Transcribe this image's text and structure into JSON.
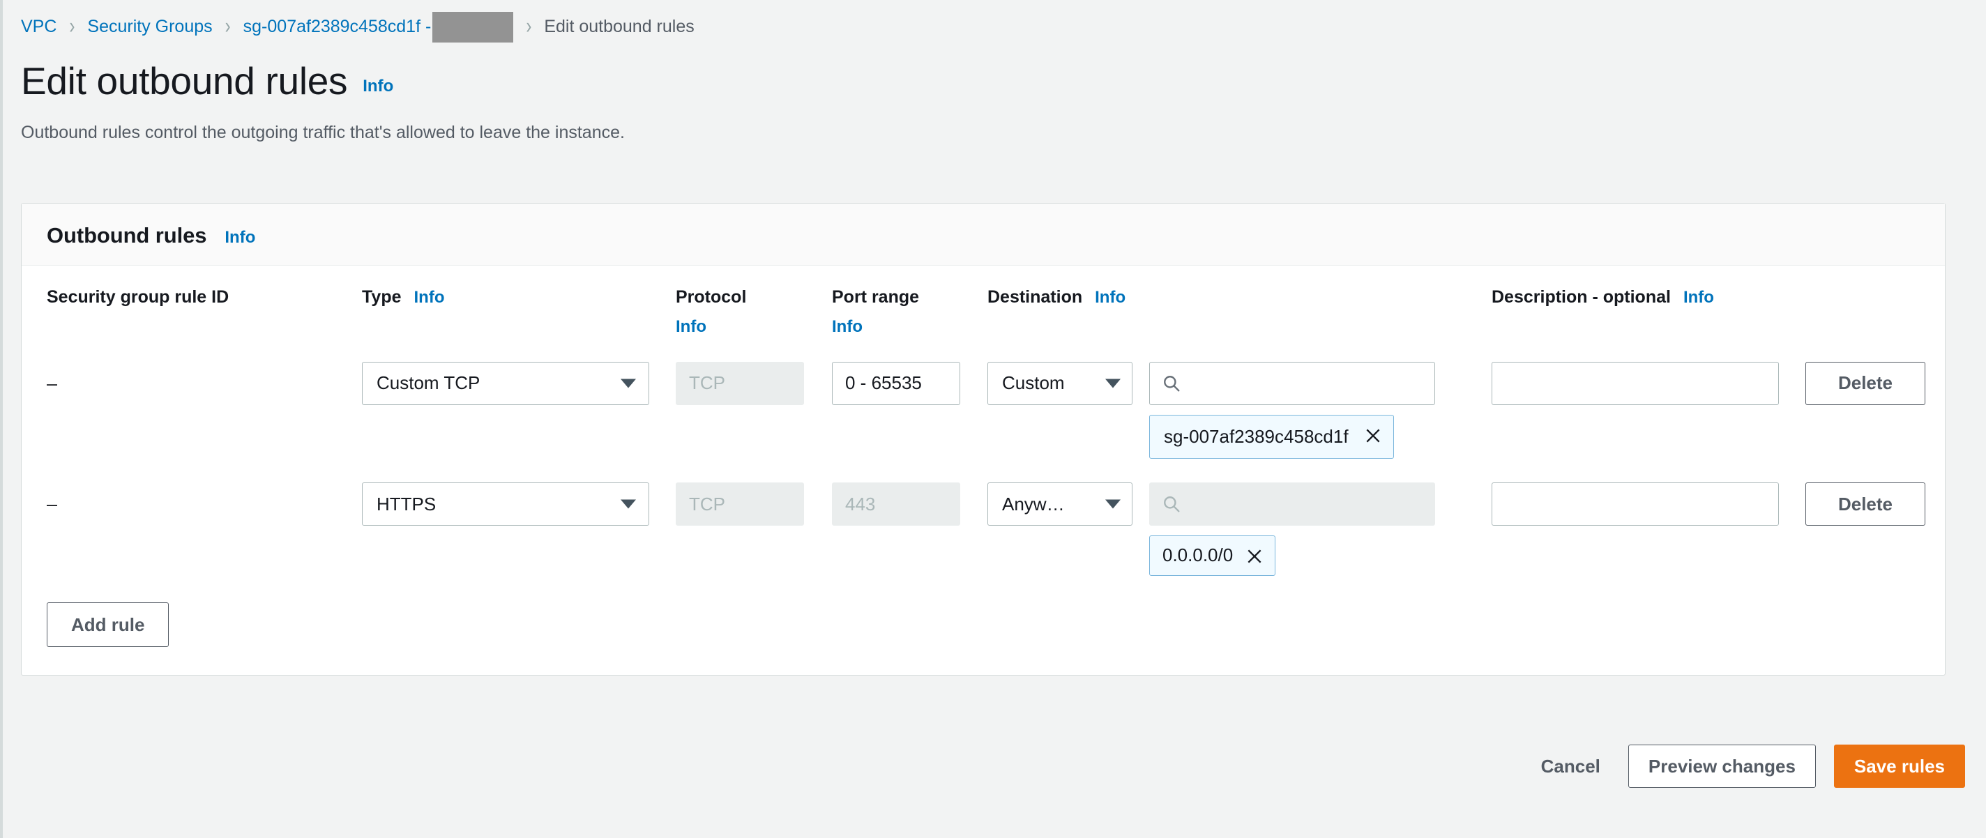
{
  "breadcrumb": {
    "items": [
      {
        "label": "VPC",
        "type": "link"
      },
      {
        "label": "Security Groups",
        "type": "link"
      },
      {
        "label": "sg-007af2389c458cd1f -",
        "type": "link",
        "redacted": true
      },
      {
        "label": "Edit outbound rules",
        "type": "current"
      }
    ],
    "separator": "›"
  },
  "page": {
    "title": "Edit outbound rules",
    "info_label": "Info",
    "description": "Outbound rules control the outgoing traffic that's allowed to leave the instance."
  },
  "card": {
    "title": "Outbound rules",
    "info_label": "Info"
  },
  "columns": {
    "rule_id": "Security group rule ID",
    "type": "Type",
    "type_info": "Info",
    "protocol": "Protocol",
    "protocol_info": "Info",
    "port_range": "Port range",
    "port_range_info": "Info",
    "destination": "Destination",
    "destination_info": "Info",
    "description": "Description - optional",
    "description_info": "Info"
  },
  "rules": [
    {
      "rule_id": "–",
      "type": "Custom TCP",
      "protocol": "TCP",
      "protocol_disabled": true,
      "port_range": "0 - 65535",
      "port_range_disabled": false,
      "destination_kind": "Custom",
      "search_value": "",
      "search_disabled": false,
      "token": "sg-007af2389c458cd1f",
      "token_multiline": true,
      "description": "",
      "delete_label": "Delete"
    },
    {
      "rule_id": "–",
      "type": "HTTPS",
      "protocol": "TCP",
      "protocol_disabled": true,
      "port_range": "443",
      "port_range_disabled": true,
      "destination_kind": "Anyw…",
      "search_value": "",
      "search_disabled": true,
      "token": "0.0.0.0/0",
      "token_multiline": false,
      "description": "",
      "delete_label": "Delete"
    }
  ],
  "buttons": {
    "add_rule": "Add rule",
    "cancel": "Cancel",
    "preview_changes": "Preview changes",
    "save_rules": "Save rules"
  },
  "colors": {
    "link": "#0073bb",
    "primary_button": "#ec7211",
    "token_background": "#f1faff",
    "token_border": "#7ab6dc",
    "page_background": "#f2f3f3",
    "disabled_field": "#eaeded",
    "redaction": "#939393"
  }
}
